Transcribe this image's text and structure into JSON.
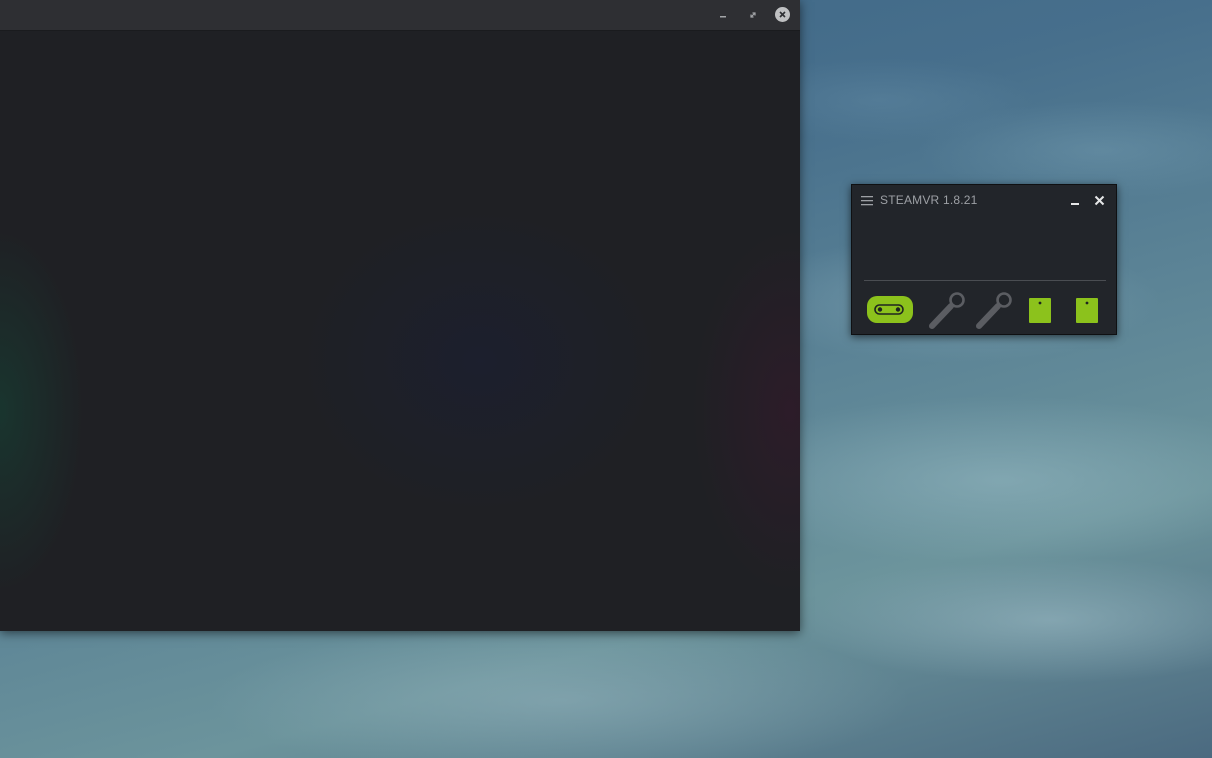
{
  "colors": {
    "accent_green": "#8cc21c",
    "device_inactive": "#5b5d62",
    "window_bg": "#22252a"
  },
  "main_window": {
    "controls": {
      "minimize_icon": "minimize-icon",
      "maximize_icon": "maximize-icon",
      "close_icon": "close-icon"
    }
  },
  "steamvr": {
    "title": "STEAMVR 1.8.21",
    "devices": [
      {
        "type": "headset",
        "icon": "headset-icon",
        "status": "active"
      },
      {
        "type": "controller",
        "icon": "controller-icon",
        "status": "inactive"
      },
      {
        "type": "controller",
        "icon": "controller-icon",
        "status": "inactive"
      },
      {
        "type": "base-station",
        "icon": "base-station-icon",
        "status": "active"
      },
      {
        "type": "base-station",
        "icon": "base-station-icon",
        "status": "active"
      }
    ]
  }
}
